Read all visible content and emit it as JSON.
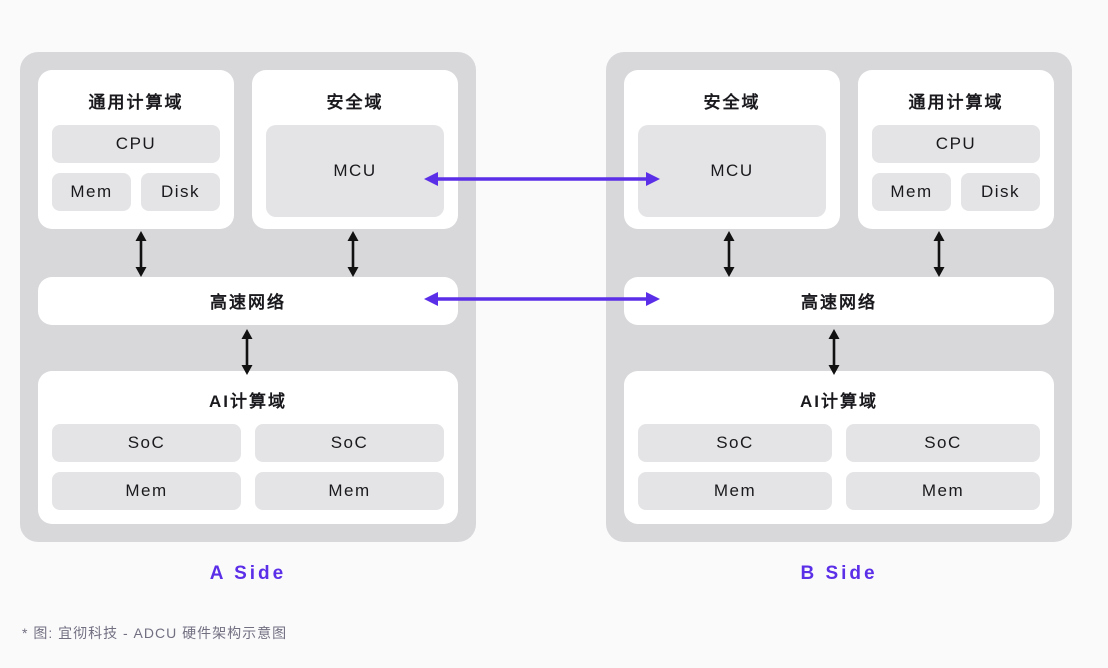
{
  "diagram": {
    "title": "ADCU 硬件架构示意图",
    "footnote": "* 图: 宜彻科技 - ADCU 硬件架构示意图",
    "colors": {
      "background": "#fafafb",
      "shell": "#d8d8db",
      "panel": "#ffffff",
      "chip": "#e4e4e6",
      "text": "#1a1a1e",
      "accent_purple": "#5b2ee8",
      "arrow_black": "#111111"
    },
    "sides": [
      {
        "id": "a",
        "caption": "A Side",
        "domains": [
          {
            "id": "general-compute",
            "title": "通用计算域",
            "chips": [
              "CPU",
              "Mem",
              "Disk"
            ]
          },
          {
            "id": "security",
            "title": "安全域",
            "chips": [
              "MCU"
            ]
          }
        ],
        "network": {
          "label": "高速网络"
        },
        "ai_domain": {
          "title": "AI计算域",
          "chips": [
            "SoC",
            "SoC",
            "Mem",
            "Mem"
          ]
        }
      },
      {
        "id": "b",
        "caption": "B Side",
        "domains": [
          {
            "id": "security",
            "title": "安全域",
            "chips": [
              "MCU"
            ]
          },
          {
            "id": "general-compute",
            "title": "通用计算域",
            "chips": [
              "CPU",
              "Mem",
              "Disk"
            ]
          }
        ],
        "network": {
          "label": "高速网络"
        },
        "ai_domain": {
          "title": "AI计算域",
          "chips": [
            "SoC",
            "SoC",
            "Mem",
            "Mem"
          ]
        }
      }
    ],
    "cross_links": [
      {
        "id": "mcu-link",
        "from": "A.安全域.MCU",
        "to": "B.安全域.MCU",
        "style": "double-arrow",
        "color": "#5b2ee8"
      },
      {
        "id": "network-link",
        "from": "A.高速网络",
        "to": "B.高速网络",
        "style": "double-arrow",
        "color": "#5b2ee8"
      }
    ],
    "internal_links": [
      {
        "id": "a-general-to-network",
        "style": "double-arrow",
        "color": "#111111"
      },
      {
        "id": "a-security-to-network",
        "style": "double-arrow",
        "color": "#111111"
      },
      {
        "id": "a-network-to-ai",
        "style": "double-arrow",
        "color": "#111111"
      },
      {
        "id": "b-security-to-network",
        "style": "double-arrow",
        "color": "#111111"
      },
      {
        "id": "b-general-to-network",
        "style": "double-arrow",
        "color": "#111111"
      },
      {
        "id": "b-network-to-ai",
        "style": "double-arrow",
        "color": "#111111"
      }
    ]
  }
}
